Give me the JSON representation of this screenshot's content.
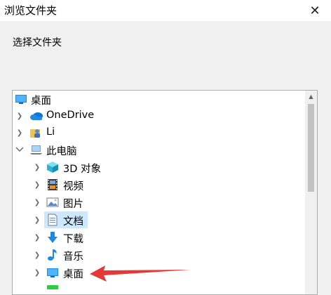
{
  "window": {
    "title": "浏览文件夹",
    "close_symbol": "✕"
  },
  "prompt": "选择文件夹",
  "tree": {
    "items": [
      {
        "label": "桌面",
        "icon": "desktop-icon",
        "expandable": false
      },
      {
        "label": "OneDrive",
        "icon": "cloud-icon",
        "expandable": true,
        "expanded": false
      },
      {
        "label": "Li",
        "icon": "user-folder-icon",
        "expandable": true,
        "expanded": false
      },
      {
        "label": "此电脑",
        "icon": "computer-icon",
        "expandable": true,
        "expanded": true
      },
      {
        "label": "3D 对象",
        "icon": "cube-icon",
        "expandable": true,
        "expanded": false
      },
      {
        "label": "视频",
        "icon": "film-icon",
        "expandable": true,
        "expanded": false
      },
      {
        "label": "图片",
        "icon": "picture-icon",
        "expandable": true,
        "expanded": false
      },
      {
        "label": "文档",
        "icon": "document-icon",
        "expandable": true,
        "expanded": false,
        "selected": true
      },
      {
        "label": "下载",
        "icon": "download-icon",
        "expandable": true,
        "expanded": false
      },
      {
        "label": "音乐",
        "icon": "music-icon",
        "expandable": true,
        "expanded": false
      },
      {
        "label": "桌面",
        "icon": "desktop-icon",
        "expandable": true,
        "expanded": false
      }
    ]
  },
  "annotation": {
    "type": "red-arrow",
    "points_to": "桌面",
    "color": "#e53935"
  },
  "colors": {
    "selection": "#cce8ff",
    "folder_blue": "#1e88e5",
    "arrow": "#e53935"
  }
}
